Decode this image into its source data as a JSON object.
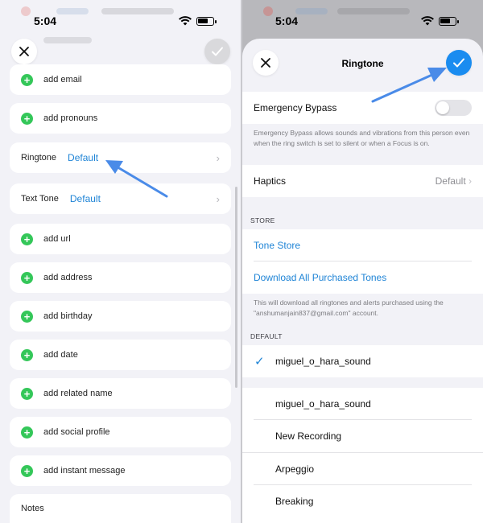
{
  "left": {
    "status_time": "5:04",
    "rows": [
      {
        "label": "add email"
      },
      {
        "label": "add pronouns"
      },
      {
        "label": "add url"
      },
      {
        "label": "add address"
      },
      {
        "label": "add birthday"
      },
      {
        "label": "add date"
      },
      {
        "label": "add related name"
      },
      {
        "label": "add social profile"
      },
      {
        "label": "add instant message"
      }
    ],
    "ringtone": {
      "label": "Ringtone",
      "value": "Default"
    },
    "text_tone": {
      "label": "Text Tone",
      "value": "Default"
    },
    "notes_label": "Notes",
    "icons": {
      "close": "close-icon",
      "confirm": "checkmark-icon",
      "add": "plus-icon",
      "chevron": "chevron-right-icon"
    }
  },
  "right": {
    "status_time": "5:04",
    "title": "Ringtone",
    "emergency_bypass": {
      "label": "Emergency Bypass",
      "enabled": false
    },
    "emergency_note": "Emergency Bypass allows sounds and vibrations from this person even when the ring switch is set to silent or when a Focus is on.",
    "haptics": {
      "label": "Haptics",
      "value": "Default"
    },
    "store_header": "STORE",
    "tone_store": "Tone Store",
    "download_all": "Download All Purchased Tones",
    "download_note": "This will download all ringtones and alerts purchased using the \"anshumanjain837@gmail.com\" account.",
    "default_header": "DEFAULT",
    "selected_tone": "miguel_o_hara_sound",
    "tones": [
      "miguel_o_hara_sound",
      "New Recording",
      "Arpeggio",
      "Breaking"
    ]
  },
  "colors": {
    "accent": "#1f84d6",
    "add_green": "#34c759",
    "arrow": "#4a8be8",
    "confirm_blue": "#1a8cf0"
  }
}
